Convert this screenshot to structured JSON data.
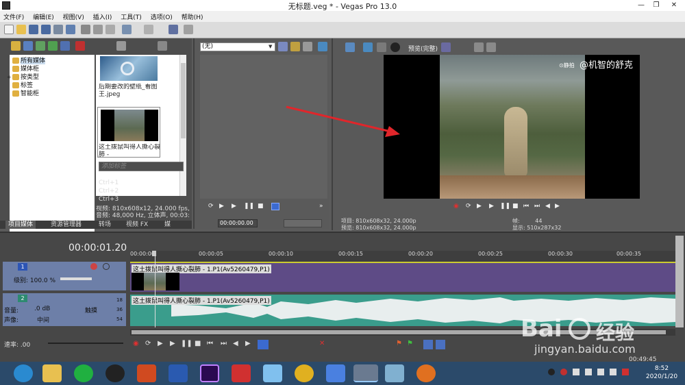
{
  "window": {
    "title": "无标题.veg * - Vegas Pro 13.0",
    "minimize": "—",
    "maximize": "❐",
    "close": "✕"
  },
  "menu": [
    "文件(F)",
    "编辑(E)",
    "视图(V)",
    "插入(I)",
    "工具(T)",
    "选项(O)",
    "帮助(H)"
  ],
  "explorer": {
    "tree": [
      "所有媒体",
      "媒体柜",
      "按类型",
      "标签",
      "智能柜"
    ],
    "media": [
      {
        "caption": "后期要改的壁纸_看图王.jpeg"
      },
      {
        "caption": "这土拨鼠叫得人撕心裂肺 - 1.P1(Av5260047..."
      }
    ],
    "tag_placeholder": "添加标签",
    "shortcuts": [
      "Ctrl+1",
      "Ctrl+2",
      "Ctrl+3"
    ],
    "info_video": "视频: 810x608x12, 24.000 fps, 00",
    "info_audio": "音频: 48,000 Hz, 立体声, 00:03:..",
    "tabs": [
      "项目媒体",
      "资源管理器",
      "转场",
      "视频 FX",
      "媒"
    ]
  },
  "trimmer": {
    "select": "(无)",
    "timecode": "00:00:00.00"
  },
  "preview": {
    "mode": "预览(完整)",
    "watermark": "@机智的舒克",
    "watermark_small": "⊙静拍",
    "project": "项目: 810x608x32, 24.000p",
    "preview_info": "预览: 810x608x32, 24.000p",
    "frame_label": "帧:",
    "frame_value": "44",
    "display": "显示: 510x287x32"
  },
  "timeline": {
    "timecode": "00:00:01.20",
    "ruler": [
      "00:00:00",
      "00:00:05",
      "00:00:10",
      "00:00:15",
      "00:00:20",
      "00:00:25",
      "00:00:30",
      "00:00:35"
    ],
    "track1": {
      "num": "1",
      "level": "级别: 100.0 %",
      "clip": "这土拨鼠叫得人撕心裂肺 - 1.P1(Av5260479,P1)"
    },
    "track2": {
      "num": "2",
      "vol_label": "音量:",
      "vol_value": ".0 dB",
      "pan_label": "声像:",
      "pan_value": "中间",
      "touch": "触摸",
      "clip": "这土拨鼠叫得人撕心裂肺 - 1.P1(Av5260479,P1)",
      "meter": [
        "18",
        "36",
        "54"
      ]
    },
    "rate": "速率: .00",
    "end_time": "00:49:45"
  },
  "taskbar": {
    "time": "8:52",
    "date": "2020/1/20"
  },
  "watermark_baidu": {
    "main": "Bai",
    "jingyan": "经验",
    "url": "jingyan.baidu.com"
  },
  "colors": {
    "track_video": "#5e4b86",
    "track_audio": "#3a9d8c",
    "arrow": "#e0262b"
  }
}
